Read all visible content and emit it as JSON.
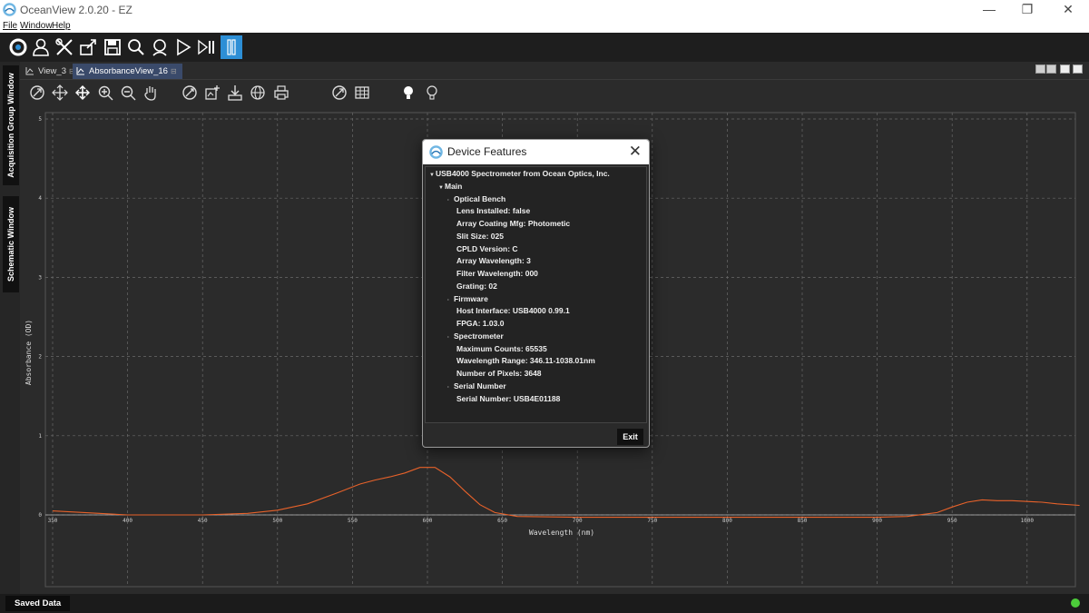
{
  "window": {
    "title": "OceanView 2.0.20  - EZ",
    "minimize": "—",
    "restore": "❐",
    "close": "✕"
  },
  "menu": [
    "File",
    "Window",
    "Help"
  ],
  "sidebar": {
    "tab_acquisition": "Acquisition Group Window",
    "tab_schematic": "Schematic Window"
  },
  "tabs": [
    {
      "label": "View_3",
      "close": "⊟"
    },
    {
      "label": "AbsorbanceView_16",
      "close": "⊟"
    }
  ],
  "bottom": {
    "saved_data": "Saved Data"
  },
  "colors": {
    "trace": "#e8622a",
    "accent": "#2d8fd6",
    "status_ok": "#4ccc3a"
  },
  "dialog": {
    "title": "Device Features",
    "close": "✕",
    "exit_label": "Exit",
    "tree": [
      {
        "level": 0,
        "text": "USB4000 Spectrometer from Ocean Optics, Inc.",
        "expanded": true
      },
      {
        "level": 1,
        "text": "Main",
        "expanded": true
      },
      {
        "level": 2,
        "text": "Optical Bench",
        "expanded": true
      },
      {
        "level": 3,
        "text": "Lens Installed: false"
      },
      {
        "level": 3,
        "text": "Array Coating Mfg: Photometic"
      },
      {
        "level": 3,
        "text": "Slit Size: 025"
      },
      {
        "level": 3,
        "text": "CPLD Version: C"
      },
      {
        "level": 3,
        "text": "Array Wavelength: 3"
      },
      {
        "level": 3,
        "text": "Filter Wavelength: 000"
      },
      {
        "level": 3,
        "text": "Grating: 02"
      },
      {
        "level": 2,
        "text": "Firmware",
        "expanded": true
      },
      {
        "level": 3,
        "text": "Host Interface: USB4000 0.99.1"
      },
      {
        "level": 3,
        "text": "FPGA: 1.03.0"
      },
      {
        "level": 2,
        "text": "Spectrometer",
        "expanded": true
      },
      {
        "level": 3,
        "text": "Maximum Counts: 65535"
      },
      {
        "level": 3,
        "text": "Wavelength Range: 346.11-1038.01nm"
      },
      {
        "level": 3,
        "text": "Number of Pixels: 3648"
      },
      {
        "level": 2,
        "text": "Serial Number",
        "expanded": true
      },
      {
        "level": 3,
        "text": "Serial Number: USB4E01188"
      }
    ]
  },
  "chart_data": {
    "type": "line",
    "xlabel": "Wavelength (nm)",
    "ylabel": "Absorbance (OD)",
    "xlim": [
      346,
      1038
    ],
    "ylim": [
      -1,
      5
    ],
    "x_ticks": [
      "350",
      "400",
      "450",
      "500",
      "550",
      "600",
      "650",
      "700",
      "750",
      "800",
      "850",
      "900",
      "950",
      "1000"
    ],
    "y_ticks": [
      "0",
      "1",
      "2",
      "3",
      "4",
      "5"
    ],
    "grid": true,
    "series": [
      {
        "x": [
          350,
          400,
          450,
          480,
          500,
          520,
          540,
          555,
          565,
          575,
          585,
          595,
          605,
          615,
          625,
          635,
          645,
          660,
          700,
          750,
          800,
          850,
          900,
          920,
          940,
          950,
          960,
          970,
          980,
          990,
          1000,
          1010,
          1020,
          1035
        ],
        "y": [
          0.05,
          0.0,
          0.0,
          0.02,
          0.06,
          0.14,
          0.28,
          0.39,
          0.44,
          0.48,
          0.53,
          0.6,
          0.6,
          0.48,
          0.3,
          0.13,
          0.03,
          -0.02,
          -0.03,
          -0.03,
          -0.03,
          -0.03,
          -0.03,
          -0.02,
          0.03,
          0.1,
          0.16,
          0.19,
          0.18,
          0.18,
          0.17,
          0.16,
          0.14,
          0.12
        ]
      }
    ]
  }
}
